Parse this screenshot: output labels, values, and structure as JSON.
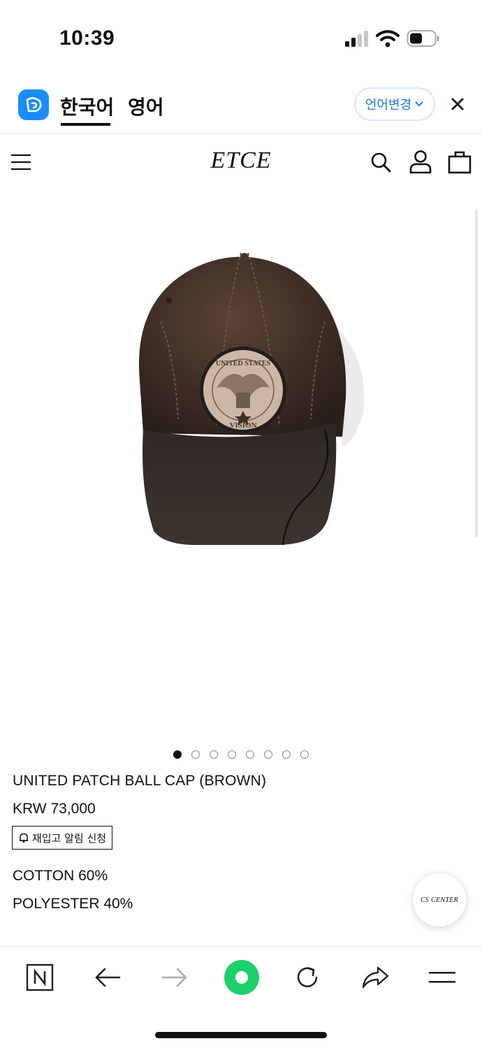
{
  "status_bar": {
    "time": "10:39",
    "icons": [
      "signal-icon",
      "wifi-icon",
      "battery-icon"
    ]
  },
  "translate_bar": {
    "languages": [
      {
        "label": "한국어",
        "active": true
      },
      {
        "label": "영어",
        "active": false
      }
    ],
    "change_label": "언어변경",
    "accent_color": "#1a7de6"
  },
  "header": {
    "logo": "ETCE",
    "icons": [
      "menu-icon",
      "search-icon",
      "user-icon",
      "bag-icon"
    ]
  },
  "carousel": {
    "total": 8,
    "active_index": 0
  },
  "product": {
    "name": "UNITED PATCH BALL CAP (BROWN)",
    "price": "KRW 73,000",
    "restock_label": "재입고 알림 신청",
    "materials": [
      "COTTON 60%",
      "POLYESTER 40%"
    ],
    "image_patch_text_top": "UNITED STATES",
    "image_patch_text_bottom": "VISION",
    "cap_color": "#3b2a22"
  },
  "cs_button": {
    "label": "CS CENTER"
  },
  "bottom_bar": {
    "icons": [
      "naver-icon",
      "back-arrow-icon",
      "forward-arrow-icon",
      "green-dot-icon",
      "reload-icon",
      "share-icon",
      "hamburger-icon"
    ],
    "green_color": "#1ed06a"
  }
}
